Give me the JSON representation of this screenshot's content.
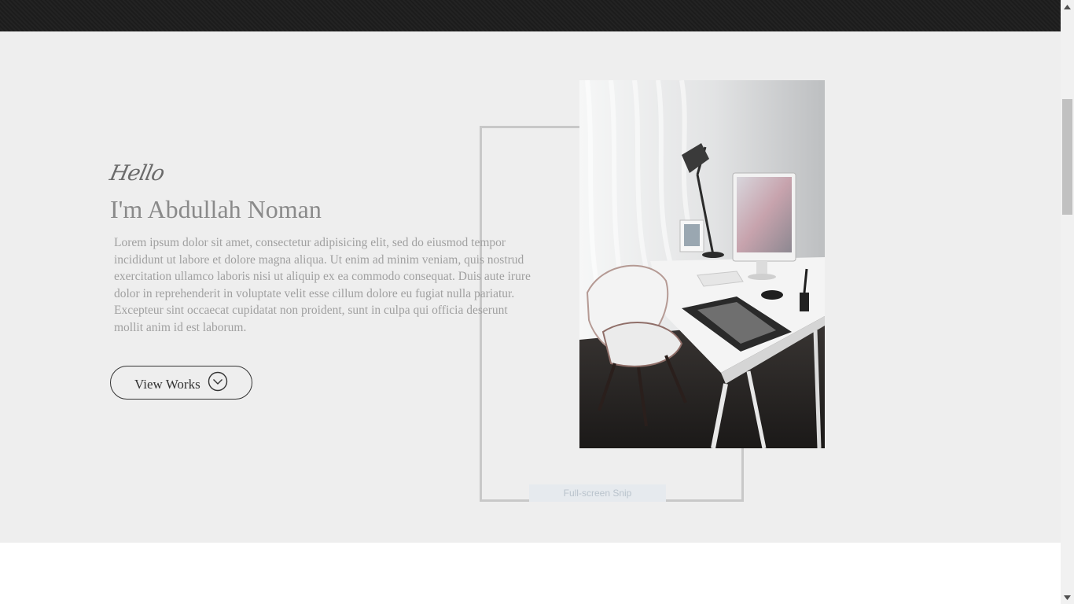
{
  "hero": {
    "greeting": "Hello",
    "name": "I'm Abdullah Noman",
    "bio": "Lorem ipsum dolor sit amet, consectetur adipisicing elit, sed do eiusmod tempor incididunt ut labore et dolore magna aliqua. Ut enim ad minim veniam, quis nostrud exercitation ullamco laboris nisi ut aliquip ex ea commodo consequat. Duis aute irure dolor in reprehenderit in voluptate velit esse cillum dolore eu fugiat nulla pariatur. Excepteur sint occaecat cupidatat non proident, sunt in culpa qui officia deserunt mollit anim id est laborum.",
    "cta_label": "View Works",
    "cta_icon": "chevron-down-circle-icon",
    "photo": "desk-workspace-photo"
  },
  "overlay": {
    "snip_label": "Full-screen Snip"
  },
  "colors": {
    "hero_bg": "#eeeeee",
    "top_bar": "#1c1c1c",
    "text_dark": "#333333",
    "text_muted": "#a0a0a0"
  }
}
